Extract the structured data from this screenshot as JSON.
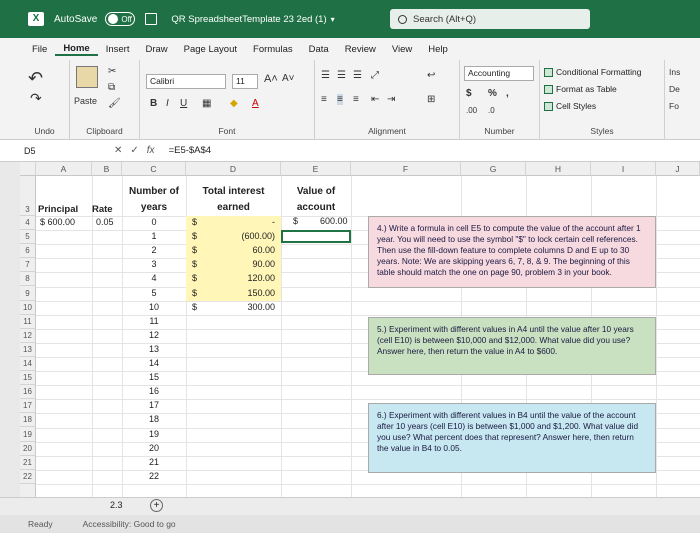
{
  "titlebar": {
    "autosave_label": "AutoSave",
    "autosave_state": "Off",
    "filename": "QR SpreadsheetTemplate 23 2ed (1)",
    "search_placeholder": "Search (Alt+Q)"
  },
  "menu": [
    "File",
    "Home",
    "Insert",
    "Draw",
    "Page Layout",
    "Formulas",
    "Data",
    "Review",
    "View",
    "Help"
  ],
  "ribbon": {
    "undo_label": "Undo",
    "clipboard_label": "Clipboard",
    "paste_label": "Paste",
    "font_name": "Calibri",
    "font_size": "11",
    "font_label": "Font",
    "alignment_label": "Alignment",
    "number_format": "Accounting",
    "number_label": "Number",
    "conditional_formatting": "Conditional Formatting",
    "format_as_table": "Format as Table",
    "cell_styles": "Cell Styles",
    "styles_label": "Styles",
    "cells_ins": "Ins",
    "cells_de": "De",
    "cells_fo": "Fo",
    "bold": "B",
    "italic": "I",
    "underline": "U",
    "grow_font": "A˄",
    "shrink_font": "A˅",
    "currency": "$",
    "percent": "%",
    "comma": ","
  },
  "formula_bar": {
    "cell_ref": "D5",
    "formula": "=E5-$A$4"
  },
  "columns": [
    "A",
    "B",
    "C",
    "D",
    "E",
    "F",
    "G",
    "H",
    "I",
    "J"
  ],
  "rows": [
    "3",
    "4",
    "5",
    "6",
    "7",
    "8",
    "9",
    "10",
    "11",
    "12",
    "13",
    "14",
    "15",
    "16",
    "17",
    "18",
    "19",
    "20",
    "21",
    "22"
  ],
  "headers": {
    "principal": "Principal",
    "rate": "Rate",
    "years_l1": "Number of",
    "years_l2": "years",
    "interest_l1": "Total interest",
    "interest_l2": "earned",
    "value_l1": "Value of",
    "value_l2": "account"
  },
  "a4_value": "$ 600.00",
  "b4_value": "0.05",
  "years": [
    "0",
    "1",
    "2",
    "3",
    "4",
    "5",
    "10",
    "11",
    "12",
    "13",
    "14",
    "15",
    "16",
    "17",
    "18",
    "19",
    "20",
    "21",
    "22"
  ],
  "interest": [
    "",
    "(600.00)",
    "60.00",
    "90.00",
    "120.00",
    "150.00",
    "300.00"
  ],
  "interest_first": "-",
  "value_e4": "600.00",
  "notes": {
    "n4": "4.) Write a formula in cell E5 to compute the value of the account after 1 year. You will need to use the symbol \"$\" to lock certain cell references.  Then use the fill-down feature to complete columns D and E up to 30 years.  Note: We are skipping years 6, 7, 8, & 9.  The beginning of this table should match the one on page 90, problem 3 in your book.",
    "n5": "5.) Experiment with different values in A4 until the value after 10 years (cell E10) is between $10,000 and $12,000.  What value did you use?  Answer here, then return the value in A4 to $600.",
    "n6": "6.) Experiment with different values in B4 until the value of the account after 10 years (cell E10) is between $1,000 and $1,200.  What value did you use?  What percent does that represent?  Answer here, then return the value in B4 to 0.05."
  },
  "sheet_tab": "2.3",
  "status": {
    "ready": "Ready",
    "accessibility": "Accessibility: Good to go"
  },
  "colors": {
    "excel_green": "#1f7145",
    "note4_bg": "#f7d9e0",
    "note5_bg": "#c9e1c1",
    "note6_bg": "#c7e7f1",
    "highlight_yellow": "#fff6b8"
  }
}
